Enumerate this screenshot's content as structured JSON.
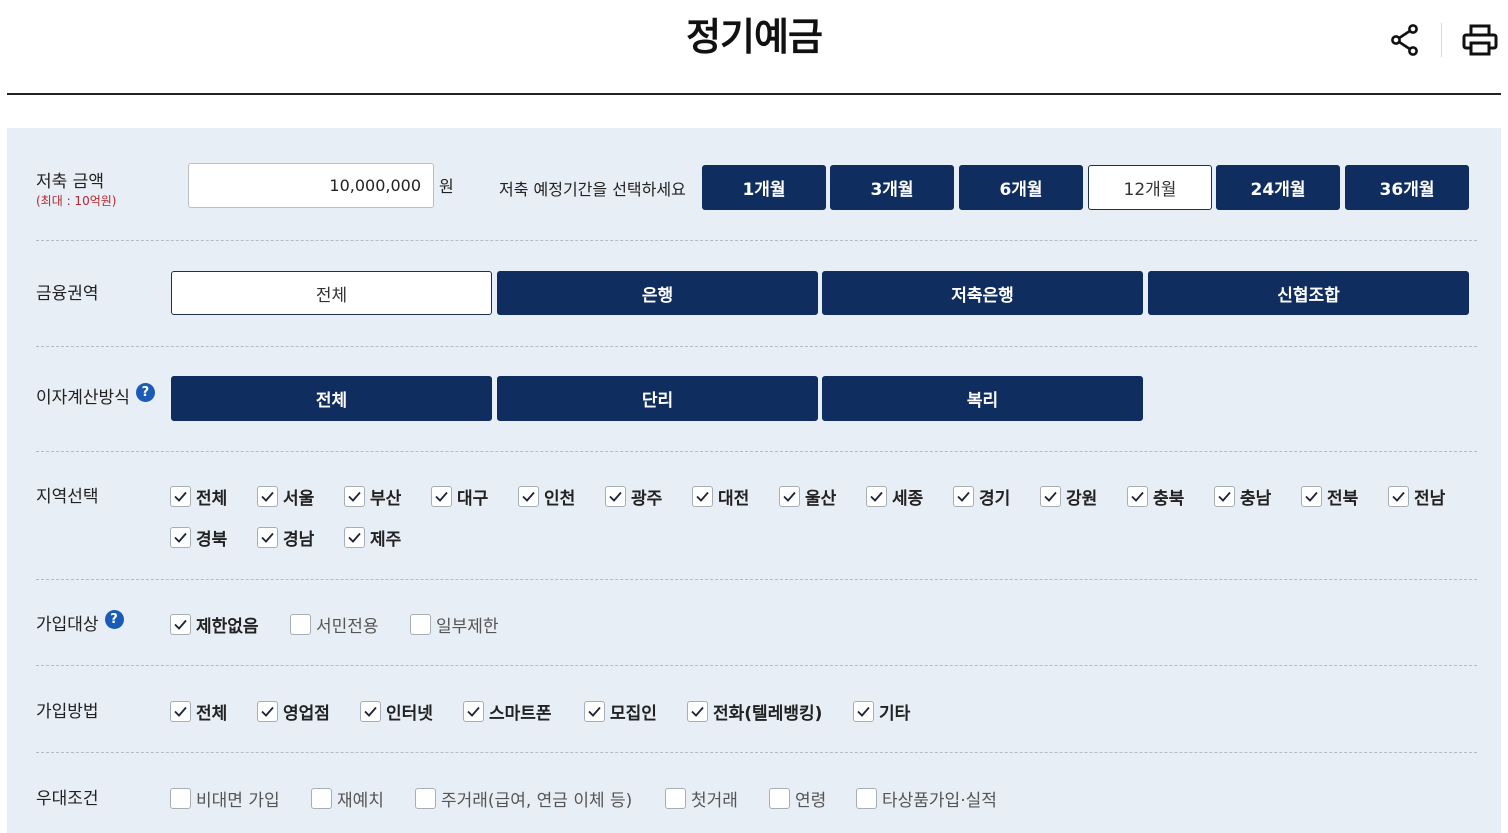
{
  "header": {
    "title": "정기예금",
    "share_icon": "share-icon",
    "print_icon": "print-icon"
  },
  "savings": {
    "label": "저축 금액",
    "max_note": "(최대 : 10억원)",
    "amount_value": "10,000,000",
    "unit": "원",
    "period_label": "저축 예정기간을 선택하세요",
    "periods": [
      "1개월",
      "3개월",
      "6개월",
      "12개월",
      "24개월",
      "36개월"
    ],
    "selected_period": "12개월"
  },
  "sector": {
    "label": "금융권역",
    "options": [
      "전체",
      "은행",
      "저축은행",
      "신협조합"
    ],
    "selected": "전체"
  },
  "interest": {
    "label": "이자계산방식",
    "options": [
      "전체",
      "단리",
      "복리"
    ]
  },
  "region": {
    "label": "지역선택",
    "options": [
      "전체",
      "서울",
      "부산",
      "대구",
      "인천",
      "광주",
      "대전",
      "울산",
      "세종",
      "경기",
      "강원",
      "충북",
      "충남",
      "전북",
      "전남",
      "경북",
      "경남",
      "제주"
    ]
  },
  "target": {
    "label": "가입대상",
    "options": [
      "제한없음",
      "서민전용",
      "일부제한"
    ],
    "checked": [
      true,
      false,
      false
    ]
  },
  "method": {
    "label": "가입방법",
    "options": [
      "전체",
      "영업점",
      "인터넷",
      "스마트폰",
      "모집인",
      "전화(텔레뱅킹)",
      "기타"
    ]
  },
  "preferential": {
    "label": "우대조건",
    "options": [
      "비대면 가입",
      "재예치",
      "주거래(급여, 연금 이체 등)",
      "첫거래",
      "연령",
      "타상품가입·실적"
    ]
  },
  "help_glyph": "?",
  "colors": {
    "primary_navy": "#0f2d5f",
    "panel_bg": "#e8eef5",
    "help_blue": "#1a5bb5",
    "note_red": "#b3272d"
  }
}
